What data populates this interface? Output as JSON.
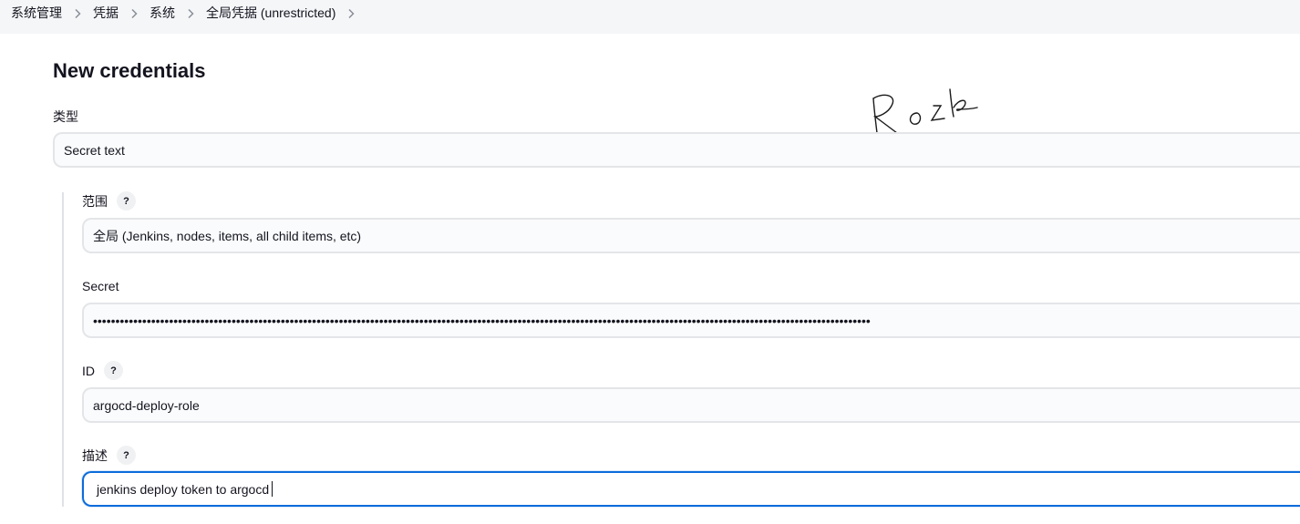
{
  "breadcrumb": {
    "items": [
      "系统管理",
      "凭据",
      "系统",
      "全局凭据 (unrestricted)"
    ]
  },
  "page": {
    "title": "New credentials"
  },
  "form": {
    "kind": {
      "label": "类型",
      "value": "Secret text"
    },
    "scope": {
      "label": "范围",
      "help": "?",
      "value": "全局 (Jenkins, nodes, items, all child items, etc)"
    },
    "secret": {
      "label": "Secret",
      "value": "••••••••••••••••••••••••••••••••••••••••••••••••••••••••••••••••••••••••••••••••••••••••••••••••••••••••••••••••••••••••••••••••••••••••••••••••••••••••••••••••••••••••••••••"
    },
    "id": {
      "label": "ID",
      "help": "?",
      "value": "argocd-deploy-role"
    },
    "description": {
      "label": "描述",
      "help": "?",
      "value": "jenkins deploy token to argocd"
    }
  },
  "colors": {
    "breadcrumb_bg": "#f5f6f8",
    "focus_border": "#0b6cdb",
    "input_border": "#e3e5e8"
  },
  "icons": {
    "separator": "chevron-right-icon",
    "help": "help-icon"
  }
}
